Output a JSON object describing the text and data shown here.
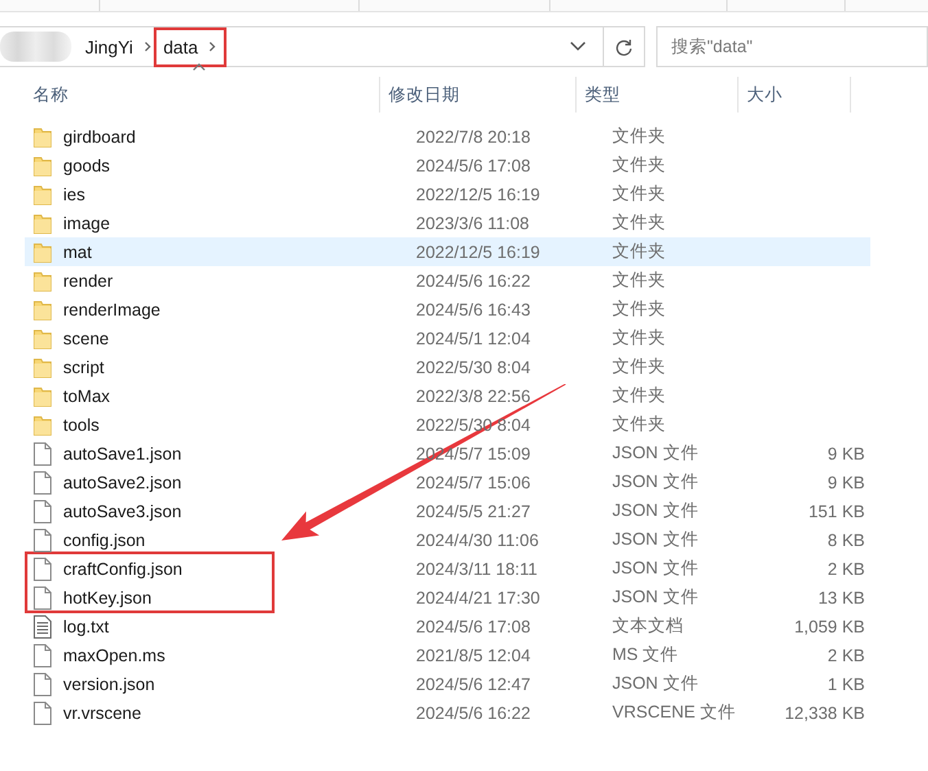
{
  "address_bar": {
    "path": [
      {
        "label": "JingYi",
        "marked": false
      },
      {
        "label": "data",
        "marked": true
      }
    ]
  },
  "search": {
    "placeholder": "搜索\"data\""
  },
  "columns": [
    "名称",
    "修改日期",
    "类型",
    "大小"
  ],
  "files": [
    {
      "kind": "folder",
      "name": "girdboard",
      "modified": "2022/7/8 20:18",
      "type": "文件夹",
      "selected": false,
      "marked": false
    },
    {
      "kind": "folder",
      "name": "goods",
      "modified": "2024/5/6 17:08",
      "type": "文件夹",
      "selected": false,
      "marked": false
    },
    {
      "kind": "folder",
      "name": "ies",
      "modified": "2022/12/5 16:19",
      "type": "文件夹",
      "selected": false,
      "marked": false
    },
    {
      "kind": "folder",
      "name": "image",
      "modified": "2023/3/6 11:08",
      "type": "文件夹",
      "selected": false,
      "marked": false
    },
    {
      "kind": "folder",
      "name": "mat",
      "modified": "2022/12/5 16:19",
      "type": "文件夹",
      "selected": true,
      "marked": false
    },
    {
      "kind": "folder",
      "name": "render",
      "modified": "2024/5/6 16:22",
      "type": "文件夹",
      "selected": false,
      "marked": false
    },
    {
      "kind": "folder",
      "name": "renderImage",
      "modified": "2024/5/6 16:43",
      "type": "文件夹",
      "selected": false,
      "marked": false
    },
    {
      "kind": "folder",
      "name": "scene",
      "modified": "2024/5/1 12:04",
      "type": "文件夹",
      "selected": false,
      "marked": false
    },
    {
      "kind": "folder",
      "name": "script",
      "modified": "2022/5/30 8:04",
      "type": "文件夹",
      "selected": false,
      "marked": false
    },
    {
      "kind": "folder",
      "name": "toMax",
      "modified": "2022/3/8 22:56",
      "type": "文件夹",
      "selected": false,
      "marked": false
    },
    {
      "kind": "folder",
      "name": "tools",
      "modified": "2022/5/30 8:04",
      "type": "文件夹",
      "selected": false,
      "marked": false
    },
    {
      "kind": "file",
      "name": "autoSave1.json",
      "modified": "2024/5/7 15:09",
      "type": "JSON 文件",
      "size": "9 KB",
      "selected": false,
      "marked": false
    },
    {
      "kind": "file",
      "name": "autoSave2.json",
      "modified": "2024/5/7 15:06",
      "type": "JSON 文件",
      "size": "9 KB",
      "selected": false,
      "marked": false
    },
    {
      "kind": "file",
      "name": "autoSave3.json",
      "modified": "2024/5/5 21:27",
      "type": "JSON 文件",
      "size": "151 KB",
      "selected": false,
      "marked": false
    },
    {
      "kind": "file",
      "name": "config.json",
      "modified": "2024/4/30 11:06",
      "type": "JSON 文件",
      "size": "8 KB",
      "selected": false,
      "marked": false
    },
    {
      "kind": "file",
      "name": "craftConfig.json",
      "modified": "2024/3/11 18:11",
      "type": "JSON 文件",
      "size": "2 KB",
      "selected": false,
      "marked": true
    },
    {
      "kind": "file",
      "name": "hotKey.json",
      "modified": "2024/4/21 17:30",
      "type": "JSON 文件",
      "size": "13 KB",
      "selected": false,
      "marked": true
    },
    {
      "kind": "text",
      "name": "log.txt",
      "modified": "2024/5/6 17:08",
      "type": "文本文档",
      "size": "1,059 KB",
      "selected": false,
      "marked": false
    },
    {
      "kind": "file",
      "name": "maxOpen.ms",
      "modified": "2021/8/5 12:04",
      "type": "MS 文件",
      "size": "2 KB",
      "selected": false,
      "marked": false
    },
    {
      "kind": "file",
      "name": "version.json",
      "modified": "2024/5/6 12:47",
      "type": "JSON 文件",
      "size": "1 KB",
      "selected": false,
      "marked": false
    },
    {
      "kind": "file",
      "name": "vr.vrscene",
      "modified": "2024/5/6 16:22",
      "type": "VRSCENE 文件",
      "size": "12,338 KB",
      "selected": false,
      "marked": false
    }
  ]
}
